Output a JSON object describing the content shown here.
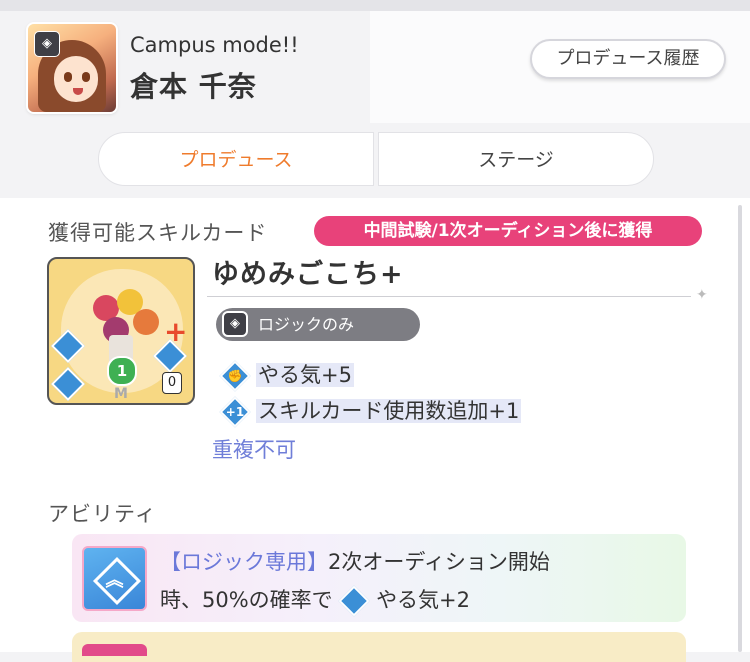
{
  "header": {
    "subtitle": "Campus mode!!",
    "character_name": "倉本 千奈",
    "history_button": "プロデュース履歴"
  },
  "tabs": [
    {
      "label": "プロデュース",
      "active": true
    },
    {
      "label": "ステージ",
      "active": false
    }
  ],
  "skill_section": {
    "title": "獲得可能スキルカード",
    "acquire_tag": "中間試験/1次オーディション後に獲得",
    "card": {
      "name": "ゆめみごこち+",
      "plan_badge": "ロジックのみ",
      "cost": "1",
      "count": "0",
      "rarity_mark": "M",
      "effects": [
        {
          "icon": "motivation-icon",
          "text": "やる気+5"
        },
        {
          "icon": "card-draw-plus-icon",
          "text": "スキルカード使用数追加+1"
        }
      ],
      "duplicate_note": "重複不可"
    }
  },
  "ability_section": {
    "title": "アビリティ",
    "items": [
      {
        "tag": "【ロジック専用】",
        "line1_rest": "2次オーディション開始",
        "line2_pre": "時、50%の確率で",
        "line2_effect": "やる気+2"
      }
    ]
  },
  "colors": {
    "accent_orange": "#ef7b2c",
    "tag_pink": "#e8427a",
    "plan_gray": "#7d7d83",
    "duplicate_blue": "#6f7ed8",
    "effect_blue": "#3b8fd6"
  }
}
